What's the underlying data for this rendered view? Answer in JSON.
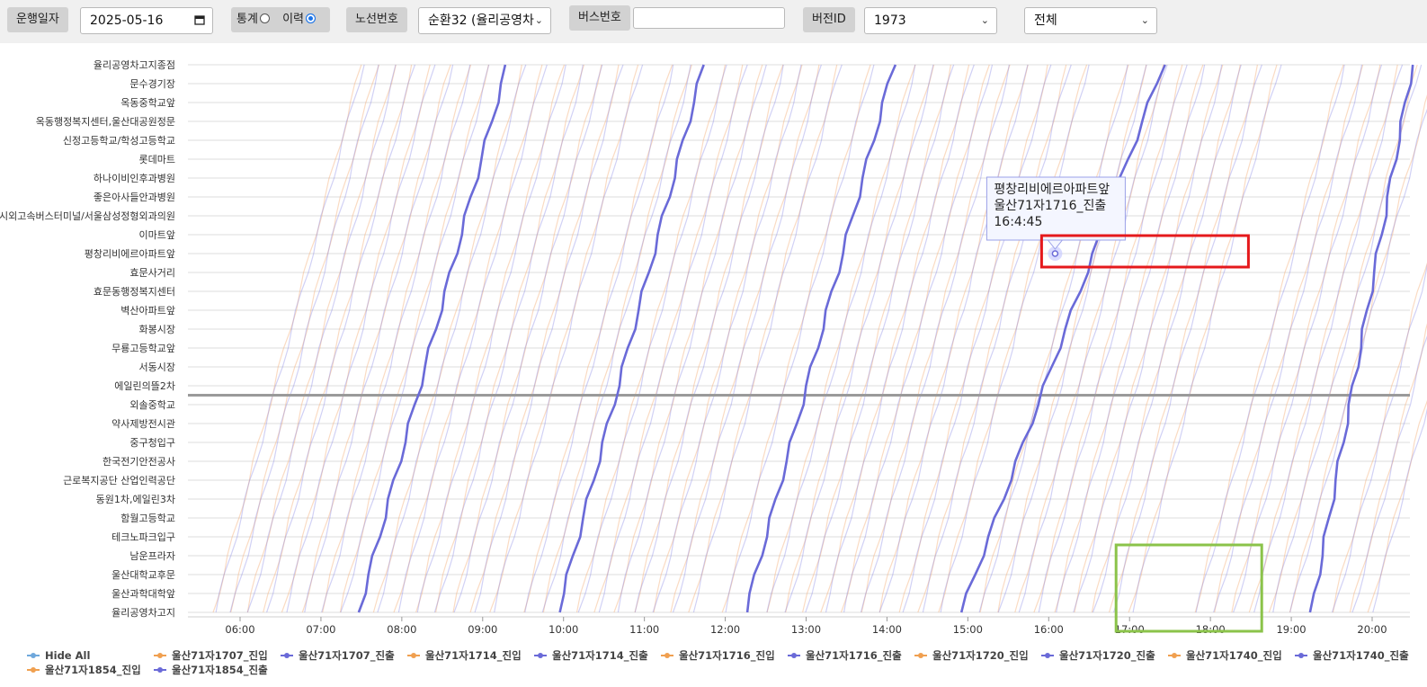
{
  "controls": {
    "date_label": "운행일자",
    "date_value": "2025-05-16",
    "mode_label": "통계",
    "mode_option_history": "이력",
    "route_label": "노선번호",
    "route_value": "순환32 (율리공영차",
    "bus_label": "버스번호",
    "bus_value": "",
    "version_label": "버전ID",
    "version_value": "1973",
    "filter_value": "전체",
    "calendar_icon": "calendar-icon",
    "dropdown_icon": "chevron-down-icon"
  },
  "chart_data": {
    "type": "line",
    "x_axis": {
      "ticks": [
        "06:00",
        "07:00",
        "08:00",
        "09:00",
        "10:00",
        "11:00",
        "12:00",
        "13:00",
        "14:00",
        "15:00",
        "16:00",
        "17:00",
        "18:00",
        "19:00",
        "20:00"
      ],
      "range": [
        "05:20",
        "20:30"
      ]
    },
    "y_axis": {
      "stops": [
        "율리공영차고지종점",
        "문수경기장",
        "옥동중학교앞",
        "옥동행정복지센터,울산대공원정문",
        "신정고등학교/학성고등학교",
        "롯데마트",
        "하나이비인후과병원",
        "좋은아사들안과병원",
        "시외고속버스터미널/서울삼성정형외과의원",
        "이마트앞",
        "평창리비에르아파트앞",
        "효문사거리",
        "효문동행정복지센터",
        "벽산아파트앞",
        "화봉시장",
        "무룡고등학교앞",
        "서동시장",
        "에일린의뜰2차",
        "외솔중학교",
        "약사제방전시관",
        "중구청입구",
        "한국전기안전공사",
        "근로복지공단 산업인력공단",
        "동원1차,에일린3차",
        "함월고등학교",
        "테크노파크입구",
        "남운프라자",
        "울산대학교후문",
        "울산과학대학앞",
        "율리공영차고지"
      ]
    },
    "grid": true,
    "reference_line_stop": "에일린의뜰2차",
    "highlighted_trips": [
      {
        "series": "울산71자1716_진출",
        "start": "07:28",
        "end": "09:18"
      },
      {
        "series": "울산71자1716_진출",
        "start": "09:56",
        "end": "11:44"
      },
      {
        "series": "울산71자1716_진출",
        "start": "12:15",
        "end": "14:05"
      },
      {
        "series": "울산71자1716_진출",
        "start": "14:55",
        "end": "17:25"
      },
      {
        "series": "울산71자1716_진출",
        "start": "19:15",
        "end": "20:30"
      }
    ],
    "background_trip_starts": [
      "05:40",
      "05:52",
      "06:05",
      "06:18",
      "06:32",
      "06:46",
      "07:00",
      "07:14",
      "07:40",
      "07:55",
      "08:10",
      "08:24",
      "08:38",
      "08:52",
      "09:06",
      "09:30",
      "09:44",
      "10:10",
      "10:24",
      "10:38",
      "10:52",
      "11:06",
      "11:20",
      "11:34",
      "11:58",
      "12:30",
      "12:44",
      "12:58",
      "13:12",
      "13:26",
      "13:40",
      "13:54",
      "14:10",
      "14:24",
      "14:38",
      "15:08",
      "15:22",
      "15:36",
      "15:50",
      "16:04",
      "16:18",
      "16:32",
      "16:46",
      "17:00",
      "17:48",
      "18:02",
      "18:16",
      "18:30",
      "18:44",
      "18:58",
      "19:30",
      "19:44",
      "19:58"
    ],
    "tooltip": {
      "stop": "평창리비에르아파트앞",
      "series": "울산71자1716_진출",
      "time": "16:4:45"
    },
    "annotations": [
      {
        "type": "box",
        "color": "#e5191c",
        "around": "tooltip point"
      },
      {
        "type": "box",
        "color": "#8bc34a",
        "around": "17:00-18:30 lower stops"
      }
    ],
    "legend": {
      "placement": "bottom",
      "items": [
        {
          "name": "Hide All",
          "color": "#6fa8dc"
        },
        {
          "name": "울산71자1707_진입",
          "color": "#f0a050"
        },
        {
          "name": "울산71자1707_진출",
          "color": "#6a6ad8"
        },
        {
          "name": "울산71자1714_진입",
          "color": "#f0a050"
        },
        {
          "name": "울산71자1714_진출",
          "color": "#6a6ad8"
        },
        {
          "name": "울산71자1716_진입",
          "color": "#f0a050"
        },
        {
          "name": "울산71자1716_진출",
          "color": "#6a6ad8"
        },
        {
          "name": "울산71자1720_진입",
          "color": "#f0a050"
        },
        {
          "name": "울산71자1720_진출",
          "color": "#6a6ad8"
        },
        {
          "name": "울산71자1740_진입",
          "color": "#f0a050"
        },
        {
          "name": "울산71자1740_진출",
          "color": "#6a6ad8"
        },
        {
          "name": "울산71자1854_진입",
          "color": "#f0a050"
        },
        {
          "name": "울산71자1854_진출",
          "color": "#6a6ad8"
        }
      ]
    },
    "colors": {
      "entry": "#f5b07a",
      "exit": "#7b7be3",
      "highlight": "#6a6ad8",
      "reference_line": "#9a9a9a"
    }
  }
}
